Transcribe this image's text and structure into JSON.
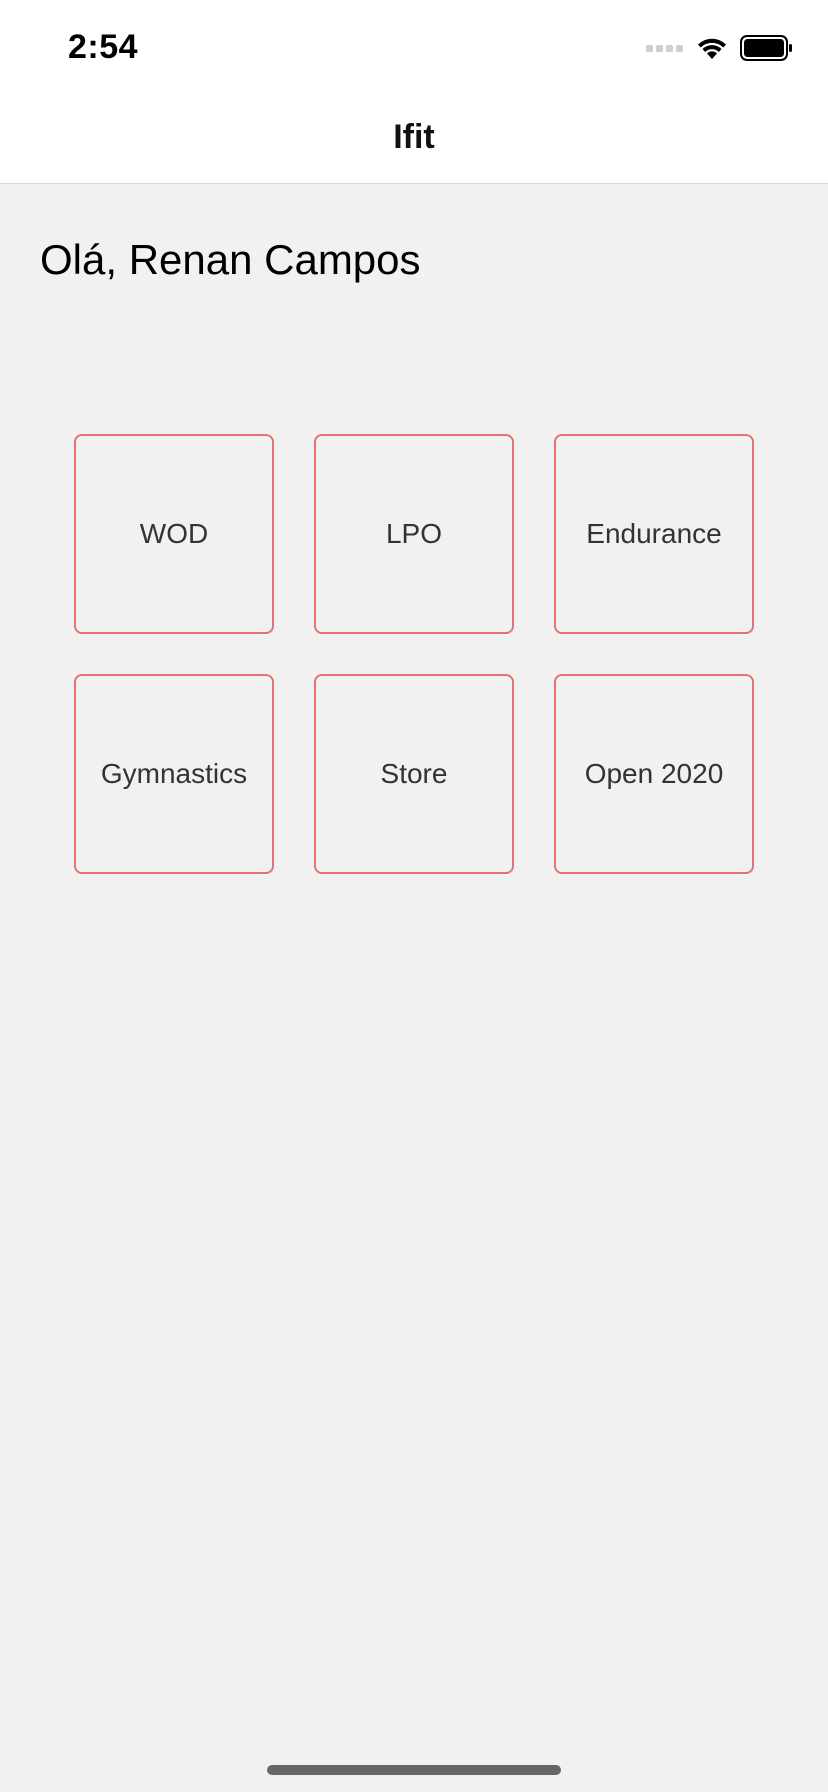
{
  "status_bar": {
    "time": "2:54",
    "icons": [
      "signal-dots-icon",
      "wifi-icon",
      "battery-icon"
    ]
  },
  "nav": {
    "title": "Ifit"
  },
  "greeting": "Olá, Renan Campos",
  "tiles": [
    {
      "label": "WOD"
    },
    {
      "label": "LPO"
    },
    {
      "label": "Endurance"
    },
    {
      "label": "Gymnastics"
    },
    {
      "label": "Store"
    },
    {
      "label": "Open 2020"
    }
  ],
  "colors": {
    "tile_border": "#e57373",
    "background": "#f1f1f1",
    "bar_background": "#ffffff"
  }
}
